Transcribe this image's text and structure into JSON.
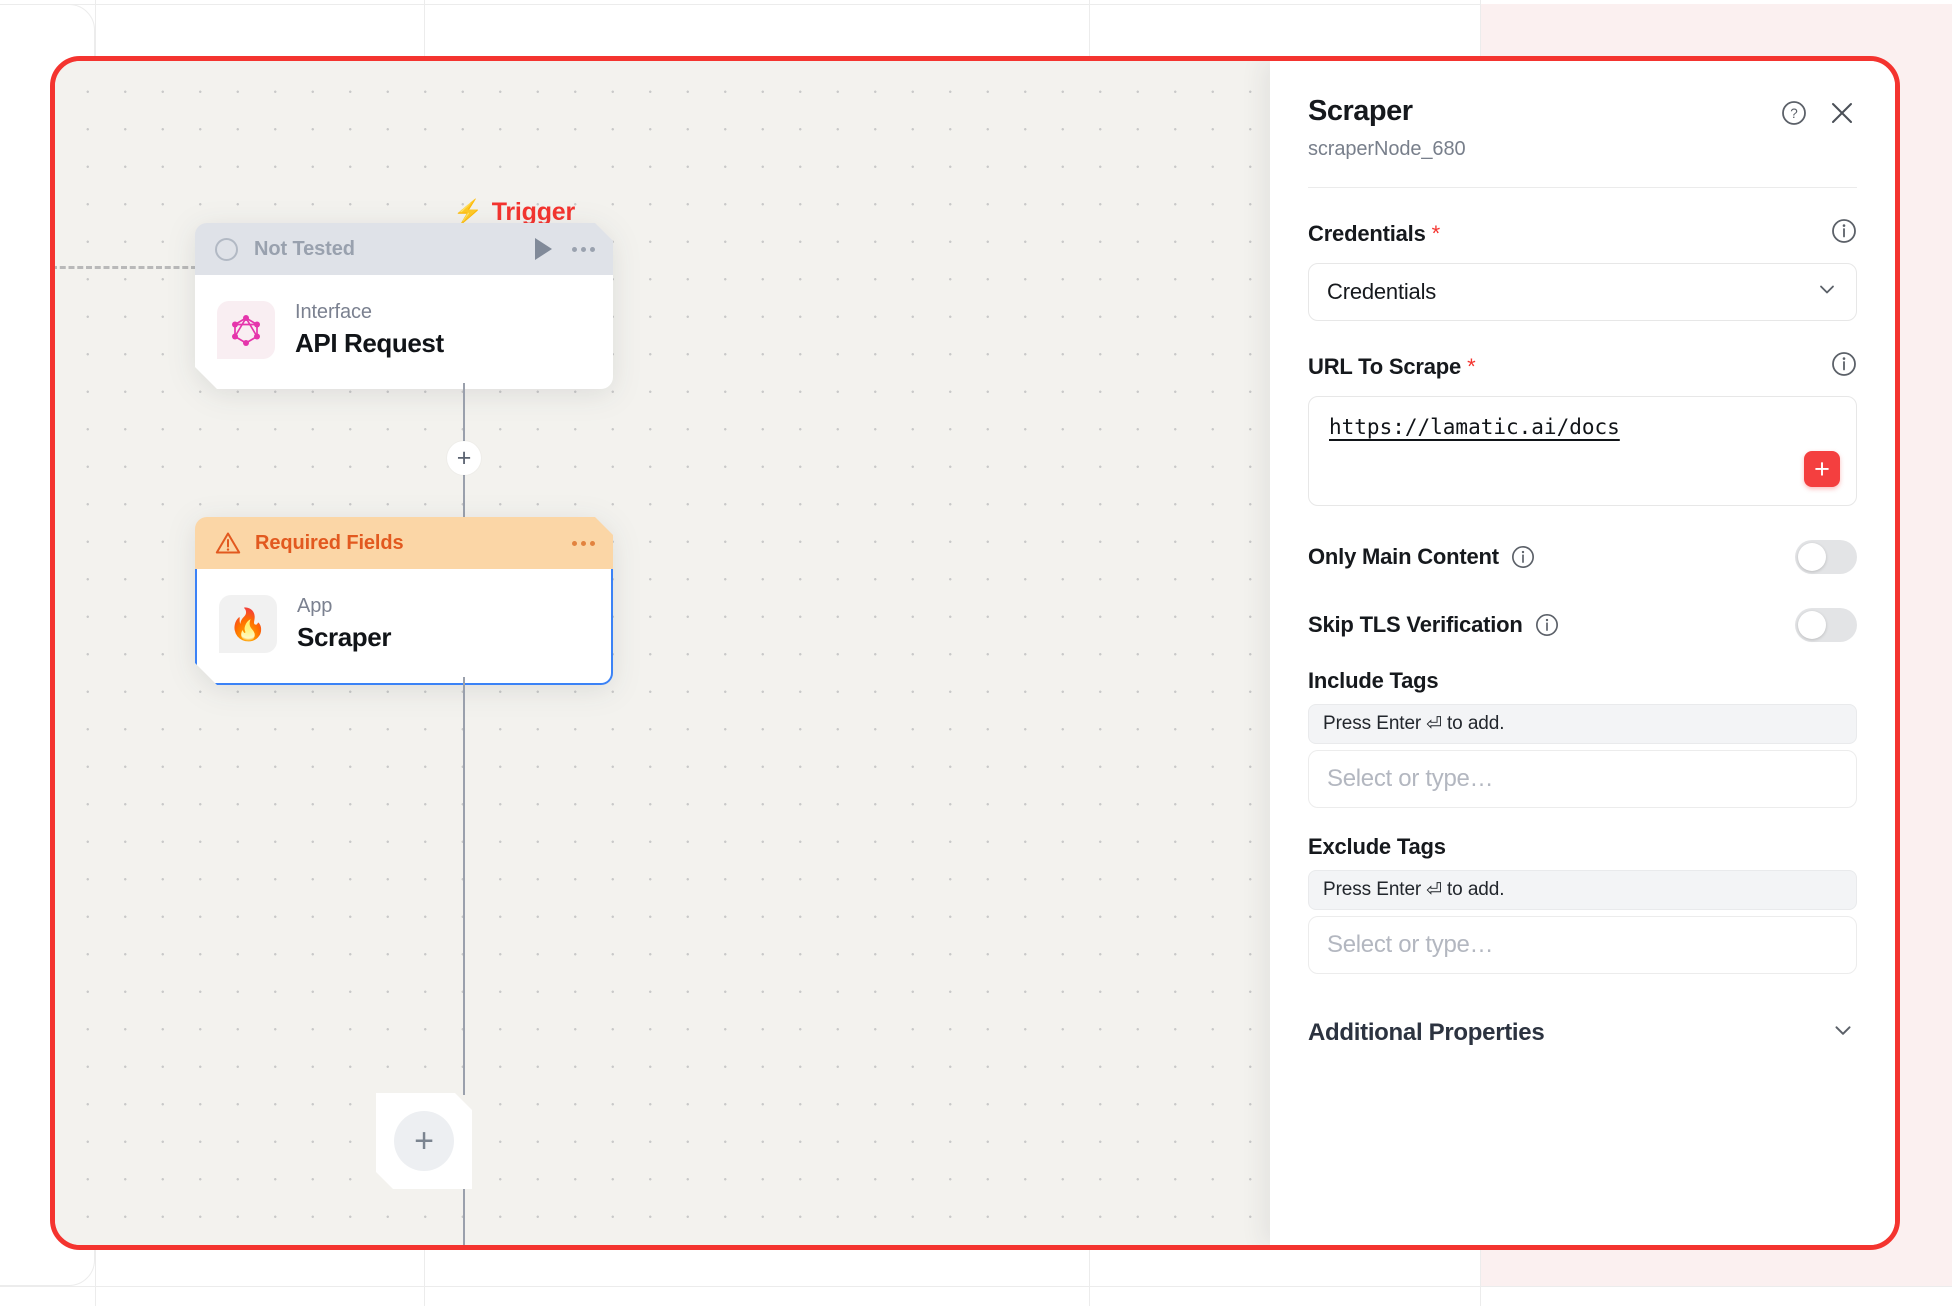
{
  "colors": {
    "highlight_border": "#f4342f",
    "trigger_red": "#f4342f",
    "required_orange": "#e2591f",
    "required_band": "#fbd6a6",
    "untested_band": "#dfe2e8",
    "selected_node_border": "#3b82f6",
    "add_button_red": "#f43f3f",
    "canvas_bg": "#f3f2ee"
  },
  "canvas": {
    "trigger": {
      "label": "Trigger",
      "icon": "lightning-bolt-icon",
      "glyph": "⚡"
    },
    "nodes": [
      {
        "status_label": "Not Tested",
        "status_type": "untested",
        "kicker": "Interface",
        "title": "API Request",
        "icon": "graphql-icon",
        "actions": {
          "run": "play-icon",
          "menu": "more-options-icon"
        }
      },
      {
        "status_label": "Required Fields",
        "status_type": "required",
        "kicker": "App",
        "title": "Scraper",
        "icon": "fire-icon",
        "glyph": "🔥",
        "actions": {
          "menu": "more-options-icon"
        }
      }
    ],
    "add_buttons": {
      "inline": "+",
      "node": "+"
    }
  },
  "panel": {
    "title": "Scraper",
    "subtitle": "scraperNode_680",
    "help_icon": "help-circle-icon",
    "close_icon": "close-icon",
    "credentials": {
      "label": "Credentials",
      "required_mark": "*",
      "info_icon": "info-icon",
      "value": "Credentials",
      "chevron": "chevron-down-icon"
    },
    "url_to_scrape": {
      "label": "URL To Scrape",
      "required_mark": "*",
      "info_icon": "info-icon",
      "value": "https://lamatic.ai/docs",
      "add_button": "+"
    },
    "toggles": [
      {
        "label": "Only Main Content",
        "info_icon": "info-icon",
        "state": "off"
      },
      {
        "label": "Skip TLS Verification",
        "info_icon": "info-icon",
        "state": "off"
      }
    ],
    "include_tags": {
      "label": "Include Tags",
      "hint_prefix": "Press Enter",
      "hint_key": "⏎",
      "hint_suffix": "to add.",
      "placeholder": "Select or type…"
    },
    "exclude_tags": {
      "label": "Exclude Tags",
      "hint_prefix": "Press Enter",
      "hint_key": "⏎",
      "hint_suffix": "to add.",
      "placeholder": "Select or type…"
    },
    "additional_properties": {
      "label": "Additional Properties",
      "chevron": "chevron-down-icon"
    }
  }
}
